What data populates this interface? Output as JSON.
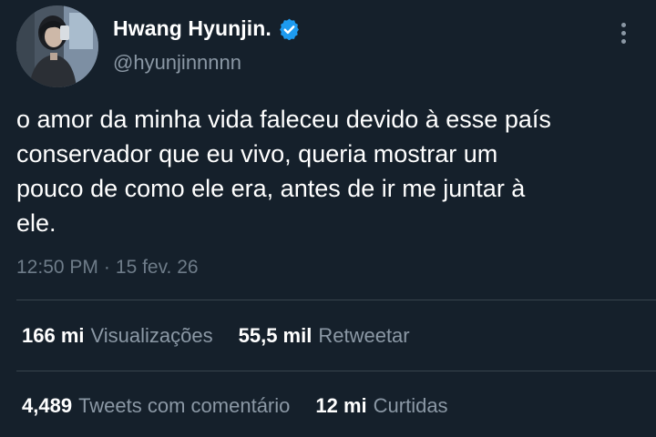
{
  "tweet": {
    "author": {
      "display_name": "Hwang Hyunjin.",
      "handle": "@hyunjinnnnn",
      "verified": true,
      "avatar_icon": "profile-photo"
    },
    "text": "o amor da minha vida faleceu devido à esse país\nconservador que eu vivo, queria mostrar um\npouco de como ele era, antes de ir me juntar à\nele.",
    "time": "12:50 PM",
    "separator": "·",
    "date": "15 fev. 26",
    "more_icon": "more-vertical-icon"
  },
  "stats": {
    "views": {
      "value": "166 mi",
      "label": "Visualizações"
    },
    "retweets": {
      "value": "55,5 mil",
      "label": "Retweetar"
    },
    "quotes": {
      "value": "4,489",
      "label": "Tweets com comentário"
    },
    "likes": {
      "value": "12 mi",
      "label": "Curtidas"
    }
  },
  "colors": {
    "background": "#15202b",
    "primary_text": "#ffffff",
    "secondary_text": "#8b98a5",
    "divider": "#38444d",
    "verified_badge": "#1d9bf0"
  }
}
